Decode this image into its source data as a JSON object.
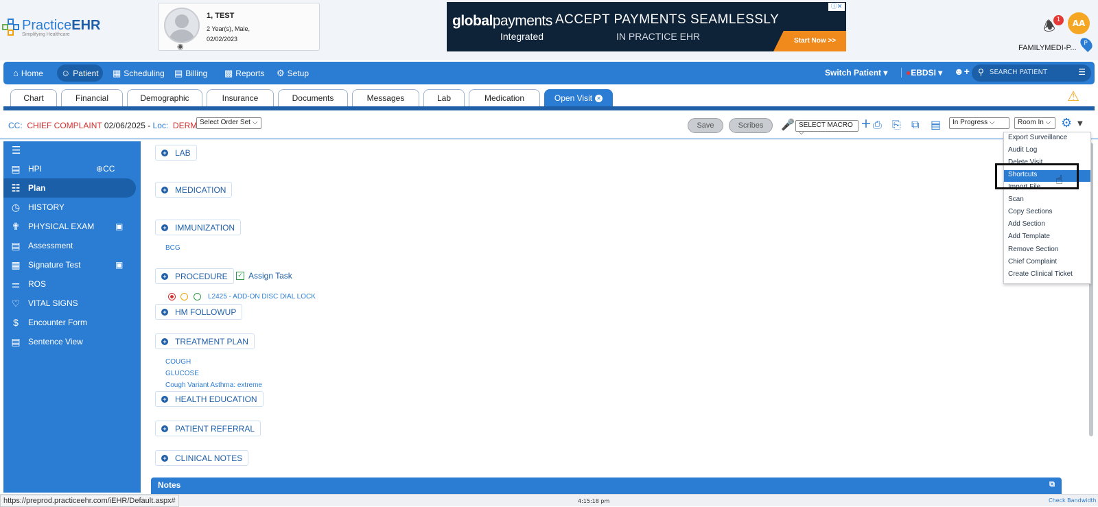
{
  "header": {
    "logo_brand": "Practice",
    "logo_brand_bold": "EHR",
    "logo_tagline": "Simplifying Healthcare",
    "patient": {
      "name": "1, TEST",
      "age_sex": "2 Year(s), Male,",
      "dob": "02/02/2023"
    },
    "ad": {
      "brand_bold": "global",
      "brand_rest": "payments",
      "sub": "Integrated",
      "headline1": "ACCEPT PAYMENTS SEAMLESSLY",
      "headline2": "IN PRACTICE EHR",
      "cta": "Start Now >>"
    },
    "notification_count": "1",
    "user_initials": "AA",
    "org": "FAMILYMEDI-P...",
    "pin_label": "P"
  },
  "nav": {
    "items": [
      {
        "label": "Home",
        "icon": "home-icon"
      },
      {
        "label": "Patient",
        "icon": "user-icon"
      },
      {
        "label": "Scheduling",
        "icon": "calendar-icon"
      },
      {
        "label": "Billing",
        "icon": "billing-icon"
      },
      {
        "label": "Reports",
        "icon": "chart-icon"
      },
      {
        "label": "Setup",
        "icon": "setup-icon"
      }
    ],
    "switch_patient": "Switch Patient",
    "facility": "EBDSI",
    "search_placeholder": "SEARCH PATIENT"
  },
  "tabs": [
    "Chart",
    "Financial",
    "Demographic",
    "Insurance",
    "Documents",
    "Messages",
    "Lab",
    "Medication",
    "Open Visit"
  ],
  "cc_bar": {
    "cc_label": "CC:",
    "complaint": "CHIEF COMPLAINT",
    "date": "02/06/2025 -",
    "loc_label": "Loc:",
    "loc": "DERMO",
    "order_set": "Select Order Set",
    "save": "Save",
    "scribes": "Scribes",
    "macro": "SELECT MACRO",
    "status": "In Progress",
    "room": "Room In"
  },
  "sidebar": {
    "cc_label": "CC",
    "items": [
      {
        "label": "HPI"
      },
      {
        "label": "Plan"
      },
      {
        "label": "HISTORY"
      },
      {
        "label": "PHYSICAL EXAM"
      },
      {
        "label": "Assessment"
      },
      {
        "label": "Signature Test"
      },
      {
        "label": "ROS"
      },
      {
        "label": "VITAL SIGNS"
      },
      {
        "label": "Encounter Form"
      },
      {
        "label": "Sentence View"
      }
    ]
  },
  "sections": {
    "lab": "LAB",
    "medication": "MEDICATION",
    "immunization": "IMMUNIZATION",
    "immunization_items": [
      "BCG"
    ],
    "procedure": "PROCEDURE",
    "assign_task": "Assign Task",
    "procedure_item": "L2425 - ADD-ON DISC DIAL LOCK",
    "hm": "HM FOLLOWUP",
    "treatment": "TREATMENT PLAN",
    "treatment_items": [
      "COUGH",
      "GLUCOSE",
      "Cough Variant Asthma: extreme"
    ],
    "health_ed": "HEALTH EDUCATION",
    "referral": "PATIENT REFERRAL",
    "clinical": "CLINICAL NOTES"
  },
  "notes_title": "Notes",
  "menu": [
    "Export Surveillance",
    "Audit Log",
    "Delete Visit",
    "Shortcuts",
    "Import File",
    "Scan",
    "Copy Sections",
    "Add Section",
    "Add Template",
    "Remove Section",
    "Chief Complaint",
    "Create Clinical Ticket"
  ],
  "status_bar": {
    "url": "https://preprod.practiceehr.com/iEHR/Default.aspx#",
    "time": "4:15:18 pm",
    "bandwidth": "Check Bandwidth"
  },
  "colors": {
    "primary": "#2b7cd3",
    "dark": "#1a5fa7",
    "alert": "#d32f2f",
    "warn": "#f5a623"
  }
}
